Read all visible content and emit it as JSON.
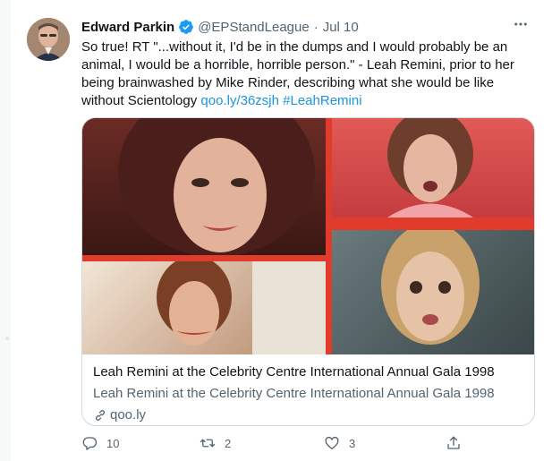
{
  "tweet": {
    "author_name": "Edward Parkin",
    "author_handle": "@EPStandLeague",
    "separator": "·",
    "date": "Jul 10",
    "text_main": "So true! RT \"...without it, I'd be in the dumps and I would probably be an animal, I would be a horrible, horrible person.\" - Leah Remini, prior to her being brainwashed by Mike Rinder, describing what she would be like without Scientology",
    "link_text": "qoo.ly/36zsjh",
    "hashtag": "#LeahRemini",
    "card": {
      "title": "Leah Remini at the Celebrity Centre International Annual Gala 1998",
      "description": "Leah Remini at the Celebrity Centre International Annual Gala 1998",
      "domain": "qoo.ly"
    },
    "actions": {
      "reply_count": "10",
      "retweet_count": "2",
      "like_count": "3"
    }
  },
  "colors": {
    "link": "#1b95e0",
    "verified": "#1d9bf0",
    "secondary_text": "#536471",
    "collage_background": "#e03b2b"
  },
  "icons": [
    "verified-badge-icon",
    "more-options-icon",
    "link-icon",
    "reply-icon",
    "retweet-icon",
    "like-icon",
    "share-icon"
  ]
}
